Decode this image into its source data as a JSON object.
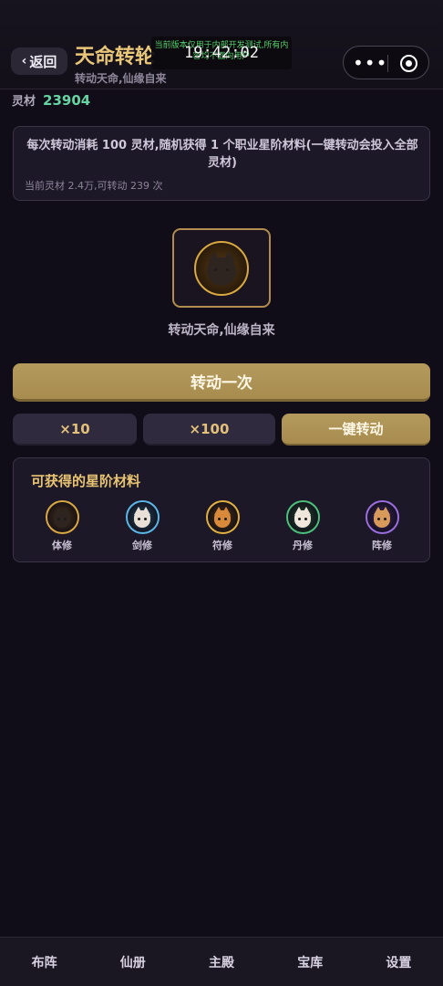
{
  "header": {
    "back_label": "返回",
    "title": "天命转轮",
    "subtitle": "转动天命,仙缘自来",
    "notice": "当前版本仅用于内部开发测试,所有内容均不面向用户",
    "clock": "19:42:02"
  },
  "currency": {
    "label": "灵材",
    "value": "23904"
  },
  "info": {
    "description": "每次转动消耗 100 灵材,随机获得 1 个职业星阶材料(一键转动会投入全部灵材)",
    "status": "当前灵材 2.4万,可转动 239 次"
  },
  "wheel": {
    "caption": "转动天命,仙缘自来"
  },
  "actions": {
    "spin_once": "转动一次",
    "spin_10": "×10",
    "spin_100": "×100",
    "spin_all": "一键转动"
  },
  "materials": {
    "heading": "可获得的星阶材料",
    "items": [
      {
        "name": "体修",
        "icon": "black-fox-icon",
        "ring": "#d9a940",
        "bg": "#4a3210",
        "fur": "#2f2520"
      },
      {
        "name": "剑修",
        "icon": "blue-cat-icon",
        "ring": "#5ab7e8",
        "bg": "#1d4a66",
        "fur": "#e8e0d6"
      },
      {
        "name": "符修",
        "icon": "orange-fox-icon",
        "ring": "#e0b040",
        "bg": "#4a3210",
        "fur": "#d88a3a"
      },
      {
        "name": "丹修",
        "icon": "calico-cat-icon",
        "ring": "#4cc07a",
        "bg": "#1c4a30",
        "fur": "#efe6dc"
      },
      {
        "name": "阵修",
        "icon": "purple-fox-icon",
        "ring": "#9b6ee0",
        "bg": "#3a2466",
        "fur": "#d89a5a"
      }
    ]
  },
  "nav": {
    "items": [
      "布阵",
      "仙册",
      "主殿",
      "宝库",
      "设置"
    ]
  }
}
